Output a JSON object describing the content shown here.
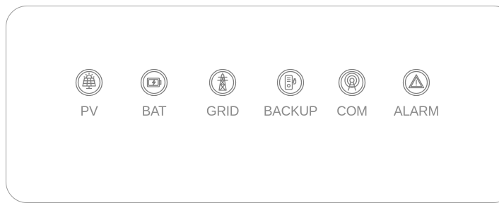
{
  "indicators": [
    {
      "id": "pv",
      "label": "PV",
      "icon": "solar-panel-icon"
    },
    {
      "id": "bat",
      "label": "BAT",
      "icon": "battery-charging-icon"
    },
    {
      "id": "grid",
      "label": "GRID",
      "icon": "transmission-tower-icon"
    },
    {
      "id": "backup",
      "label": "BACKUP",
      "icon": "backup-outlet-icon"
    },
    {
      "id": "com",
      "label": "COM",
      "icon": "communication-antenna-icon"
    },
    {
      "id": "alarm",
      "label": "ALARM",
      "icon": "alarm-warning-icon"
    }
  ],
  "colors": {
    "outline": "#9b9b9b",
    "icon": "#7d7d7d",
    "label": "#8a8a8a",
    "background": "#ffffff"
  }
}
